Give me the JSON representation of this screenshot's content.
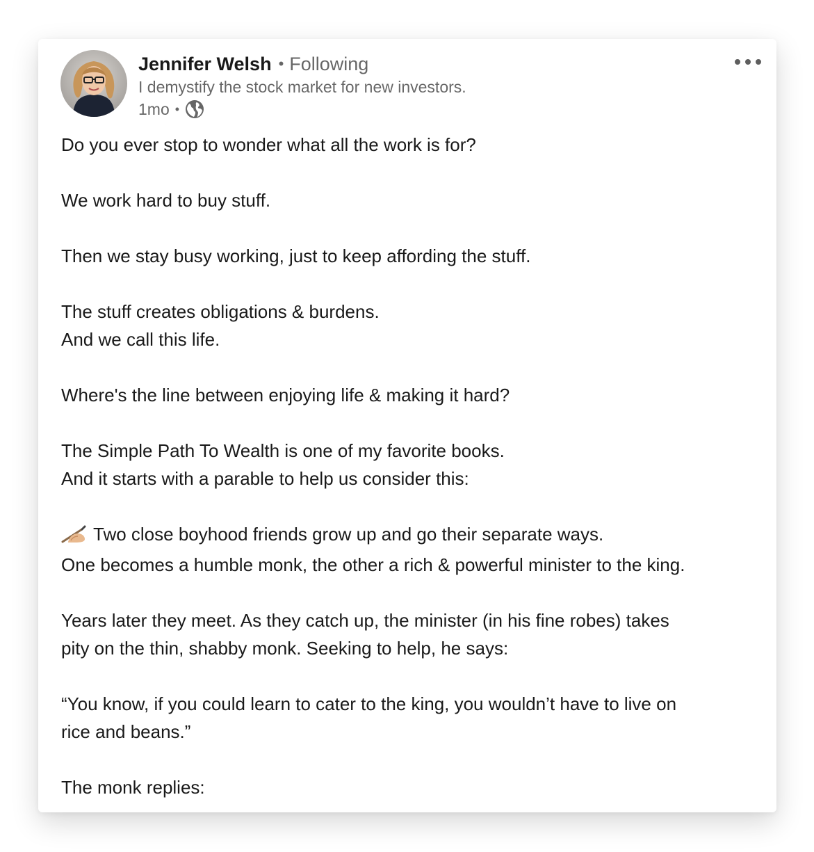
{
  "post": {
    "author": {
      "name": "Jennifer Welsh",
      "separator": "•",
      "follow_status": "Following",
      "headline": "I demystify the stock market for new investors.",
      "time_ago": "1mo",
      "meta_separator": "•",
      "visibility_icon": "globe-icon"
    },
    "more_icon": "more-horizontal-icon",
    "paragraphs": [
      [
        "Do you ever stop to wonder what all the work is for?"
      ],
      [
        "We work hard to buy stuff."
      ],
      [
        "Then we stay busy working, just to keep affording the stuff."
      ],
      [
        "The stuff creates obligations & burdens.",
        "And we call this life."
      ],
      [
        "Where's the line between enjoying life & making it hard?"
      ],
      [
        "The Simple Path To Wealth is one of my favorite books.",
        "And it starts with a parable to help us consider this:"
      ],
      [
        "Two close boyhood friends grow up and go their separate ways.",
        "One becomes a humble monk, the other a rich & powerful minister to the king."
      ],
      [
        "Years later they meet. As they catch up, the minister (in his fine robes) takes",
        "pity on the thin, shabby monk. Seeking to help, he says:"
      ],
      [
        "“You know, if you could learn to cater to the king, you wouldn’t have to live on",
        "rice and beans.”"
      ],
      [
        "The monk replies:"
      ]
    ],
    "writing_hand_emoji": "writing-hand-icon"
  },
  "colors": {
    "text_primary": "#1a1a1a",
    "text_secondary": "#666666",
    "card_background": "#ffffff"
  }
}
